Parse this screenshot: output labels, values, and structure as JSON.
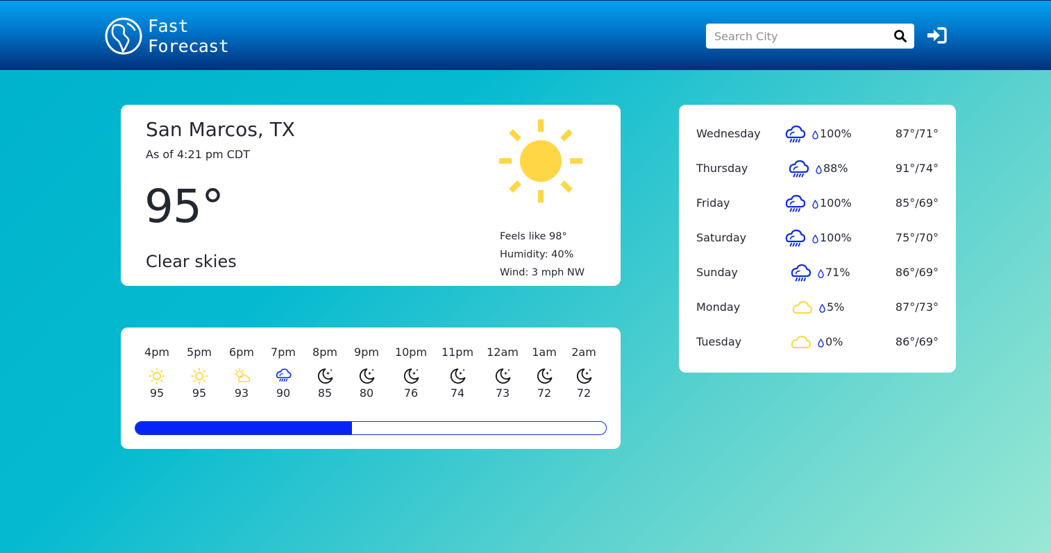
{
  "app": {
    "logo_line1": "Fast",
    "logo_line2": "Forecast"
  },
  "search": {
    "placeholder": "Search City",
    "value": ""
  },
  "icons": {
    "logo": "globe-americas-icon",
    "search": "search-icon",
    "login": "sign-in-icon"
  },
  "current": {
    "city": "San Marcos, TX",
    "as_of": "As of 4:21 pm CDT",
    "temperature": "95°",
    "condition": "Clear skies",
    "icon": "sun-icon",
    "feels_like": "Feels like 98°",
    "humidity": "Humidity: 40%",
    "wind": "Wind: 3 mph NW"
  },
  "hourly": [
    {
      "time": "4pm",
      "temp": "95",
      "icon": "sun-icon"
    },
    {
      "time": "5pm",
      "temp": "95",
      "icon": "sun-icon"
    },
    {
      "time": "6pm",
      "temp": "93",
      "icon": "partly-cloudy-icon"
    },
    {
      "time": "7pm",
      "temp": "90",
      "icon": "rain-cloud-icon"
    },
    {
      "time": "8pm",
      "temp": "85",
      "icon": "moon-stars-icon"
    },
    {
      "time": "9pm",
      "temp": "80",
      "icon": "moon-stars-icon"
    },
    {
      "time": "10pm",
      "temp": "76",
      "icon": "moon-stars-icon"
    },
    {
      "time": "11pm",
      "temp": "74",
      "icon": "moon-stars-icon"
    },
    {
      "time": "12am",
      "temp": "73",
      "icon": "moon-stars-icon"
    },
    {
      "time": "1am",
      "temp": "72",
      "icon": "moon-stars-icon"
    },
    {
      "time": "2am",
      "temp": "72",
      "icon": "moon-stars-icon"
    }
  ],
  "hourly_scroll_progress": 0.46,
  "daily": [
    {
      "day": "Wednesday",
      "precip": "100%",
      "range": "87°/71°",
      "icon": "rain-cloud-icon"
    },
    {
      "day": "Thursday",
      "precip": "88%",
      "range": "91°/74°",
      "icon": "rain-cloud-icon"
    },
    {
      "day": "Friday",
      "precip": "100%",
      "range": "85°/69°",
      "icon": "rain-cloud-icon"
    },
    {
      "day": "Saturday",
      "precip": "100%",
      "range": "75°/70°",
      "icon": "rain-cloud-icon"
    },
    {
      "day": "Sunday",
      "precip": "71%",
      "range": "86°/69°",
      "icon": "rain-cloud-icon"
    },
    {
      "day": "Monday",
      "precip": "5%",
      "range": "87°/73°",
      "icon": "cloud-icon"
    },
    {
      "day": "Tuesday",
      "precip": "0%",
      "range": "86°/69°",
      "icon": "cloud-icon"
    }
  ],
  "colors": {
    "header_top": "#05a3f0",
    "header_bottom": "#002f7a",
    "sun": "#ffd645",
    "rain_icon": "#0a2de0",
    "progress_fill": "#0524f5"
  }
}
